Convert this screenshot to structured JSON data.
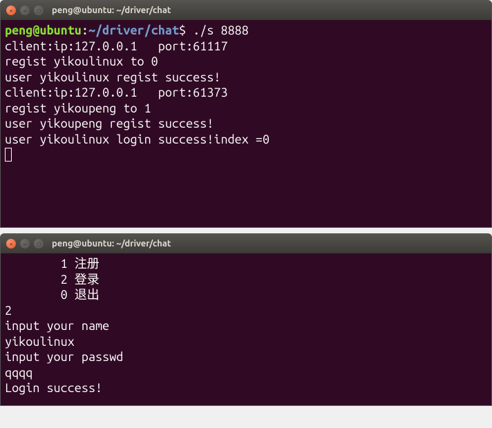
{
  "terminal1": {
    "title": "peng@ubuntu: ~/driver/chat",
    "prompt_user": "peng@ubuntu",
    "prompt_sep": ":",
    "prompt_path": "~/driver/chat",
    "prompt_dollar": "$ ",
    "command": "./s 8888",
    "lines": [
      "client:ip:127.0.0.1   port:61117",
      "regist yikoulinux to 0",
      "user yikoulinux regist success!",
      "client:ip:127.0.0.1   port:61373",
      "regist yikoupeng to 1",
      "user yikoupeng regist success!",
      "user yikoulinux login success!index =0"
    ]
  },
  "terminal2": {
    "title": "peng@ubuntu: ~/driver/chat",
    "menu": [
      "        1 注册",
      "        2 登录",
      "        0 退出"
    ],
    "lines": [
      "2",
      "input your name",
      "yikoulinux",
      "input your passwd",
      "qqqq",
      "Login success!"
    ]
  },
  "icons": {
    "close": "close-icon",
    "minimize": "minimize-icon",
    "maximize": "maximize-icon"
  }
}
